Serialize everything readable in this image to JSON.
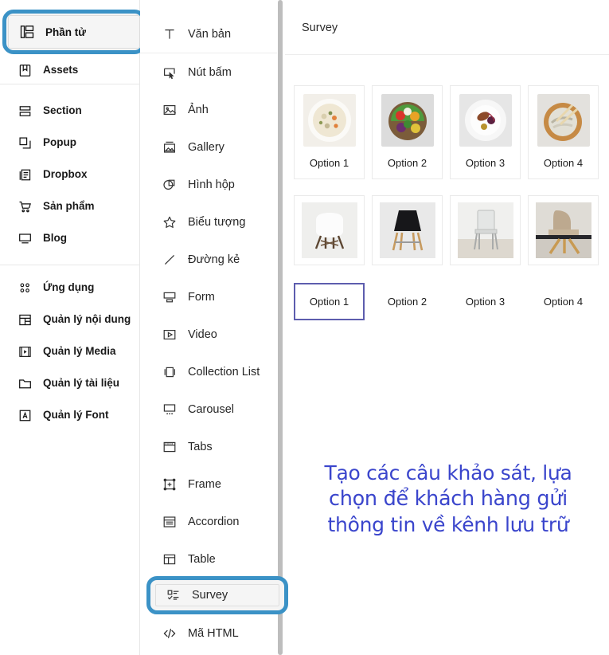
{
  "sidebar": {
    "selected_item": {
      "label": "Phần tử",
      "icon": "elements-icon"
    },
    "items_top": [
      {
        "label": "Assets",
        "icon": "assets-bookmark-icon"
      }
    ],
    "items_mid": [
      {
        "label": "Section",
        "icon": "section-icon"
      },
      {
        "label": "Popup",
        "icon": "popup-icon"
      },
      {
        "label": "Dropbox",
        "icon": "dropbox-icon"
      },
      {
        "label": "Sản phẩm",
        "icon": "cart-icon"
      },
      {
        "label": "Blog",
        "icon": "monitor-icon"
      }
    ],
    "items_bottom": [
      {
        "label": "Ứng dụng",
        "icon": "apps-grid-icon"
      },
      {
        "label": "Quản lý nội dung",
        "icon": "content-manager-icon"
      },
      {
        "label": "Quản lý Media",
        "icon": "media-manager-icon"
      },
      {
        "label": "Quản lý tài liệu",
        "icon": "folder-icon"
      },
      {
        "label": "Quản lý Font",
        "icon": "font-icon"
      }
    ]
  },
  "elements_panel": {
    "items": [
      {
        "label": "Văn bản",
        "icon": "text-t-icon"
      },
      {
        "label": "Nút bấm",
        "icon": "button-cursor-icon"
      },
      {
        "label": "Ảnh",
        "icon": "image-icon"
      },
      {
        "label": "Gallery",
        "icon": "gallery-icon"
      },
      {
        "label": "Hình hộp",
        "icon": "shape-box-icon"
      },
      {
        "label": "Biểu tượng",
        "icon": "star-icon"
      },
      {
        "label": "Đường kẻ",
        "icon": "line-icon"
      },
      {
        "label": "Form",
        "icon": "form-icon"
      },
      {
        "label": "Video",
        "icon": "video-play-icon"
      },
      {
        "label": "Collection List",
        "icon": "collection-list-icon"
      },
      {
        "label": "Carousel",
        "icon": "carousel-icon"
      },
      {
        "label": "Tabs",
        "icon": "tabs-icon"
      },
      {
        "label": "Frame",
        "icon": "frame-icon"
      },
      {
        "label": "Accordion",
        "icon": "accordion-icon"
      },
      {
        "label": "Table",
        "icon": "table-icon"
      }
    ],
    "selected_item": {
      "label": "Survey",
      "icon": "survey-checklist-icon"
    },
    "items_after": [
      {
        "label": "Mã HTML",
        "icon": "code-icon"
      }
    ]
  },
  "canvas": {
    "title": "Survey",
    "row1": {
      "options": [
        {
          "label": "Option 1",
          "image": "bowl-of-soup-photo"
        },
        {
          "label": "Option 2",
          "image": "colorful-salad-bowl-photo"
        },
        {
          "label": "Option 3",
          "image": "plated-dessert-photo"
        },
        {
          "label": "Option 4",
          "image": "wooden-bowl-dish-photo"
        }
      ]
    },
    "row2": {
      "options": [
        {
          "label": "Option 1",
          "image": "white-eames-chair-photo",
          "selected": true
        },
        {
          "label": "Option 2",
          "image": "black-chair-photo",
          "selected": false
        },
        {
          "label": "Option 3",
          "image": "grey-dining-chair-photo",
          "selected": false
        },
        {
          "label": "Option 4",
          "image": "beige-swivel-chair-photo",
          "selected": false
        }
      ]
    },
    "annotation": {
      "line1": "Tạo các câu khảo sát, lựa",
      "line2": "chọn để khách hàng gửi",
      "line3": "thông tin về kênh lưu trữ"
    }
  },
  "colors": {
    "highlight_ring": "#3b92c6",
    "selected_option_border": "#5d5dae",
    "annotation_text": "#3a45cc",
    "panel_border": "#e6e6e6"
  }
}
